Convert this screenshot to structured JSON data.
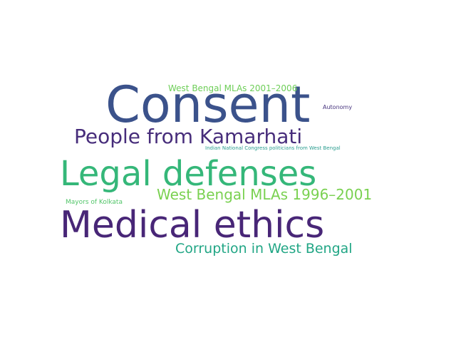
{
  "background": "#ffffff",
  "words": [
    {
      "text": "Consent",
      "color": "#3b528b"
    },
    {
      "text": "Legal defenses",
      "color": "#35b779"
    },
    {
      "text": "Medical ethics",
      "color": "#482677"
    },
    {
      "text": "People from Kamarhati",
      "color": "#472d7b"
    },
    {
      "text": "West Bengal MLAs 1996–2001",
      "color": "#7ad151"
    },
    {
      "text": "Corruption in West Bengal",
      "color": "#21a685"
    },
    {
      "text": "West Bengal MLAs 2001–2006",
      "color": "#6ece58"
    },
    {
      "text": "Autonomy",
      "color": "#46337e"
    },
    {
      "text": "Indian National Congress politicians from West Bengal",
      "color": "#2a9d8f"
    },
    {
      "text": "Mayors of Kolkata",
      "color": "#52c569"
    }
  ]
}
